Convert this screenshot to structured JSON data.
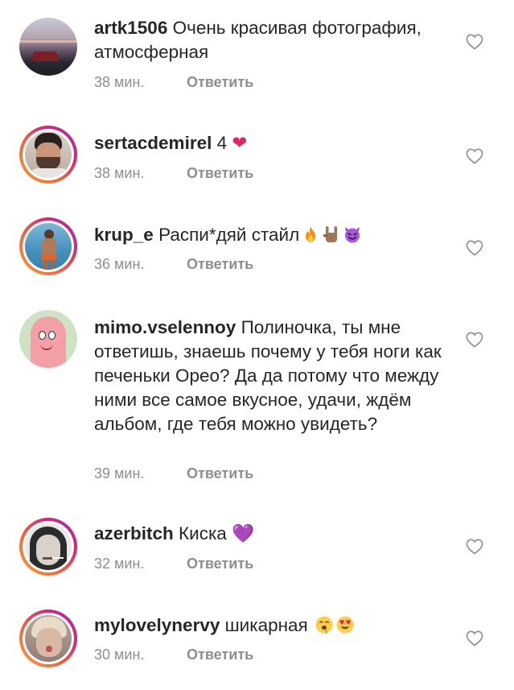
{
  "comments": [
    {
      "username": "artk1506",
      "text": "Очень красивая фотография, атмосферная",
      "time": "38 мин.",
      "reply": "Ответить"
    },
    {
      "username": "sertacdemirel",
      "text": "4",
      "emoji": "❤",
      "time": "38 мин.",
      "reply": "Ответить"
    },
    {
      "username": "krup_e",
      "text": "Распи*дяй стайл",
      "time": "36 мин.",
      "reply": "Ответить"
    },
    {
      "username": "mimo.vselennoy",
      "text": "Полиночка, ты мне ответишь, знаешь почему у тебя ноги как печеньки Орео? Да да потому что между ними все самое вкусное, удачи, ждём альбом, где тебя можно увидеть?",
      "time": "39 мин.",
      "reply": "Ответить"
    },
    {
      "username": "azerbitch",
      "text": "Киска",
      "emoji": "💜",
      "time": "32 мин.",
      "reply": "Ответить"
    },
    {
      "username": "mylovelynervy",
      "text": "шикарная",
      "time": "30 мин.",
      "reply": "Ответить"
    }
  ],
  "icons": {
    "like": "heart-outline-icon",
    "fire": "fire-emoji-icon",
    "horns": "sign-of-horns-emoji-icon",
    "devil": "smiling-devil-emoji-icon",
    "drool": "drooling-face-emoji-icon",
    "heart_eyes": "heart-eyes-emoji-icon"
  },
  "colors": {
    "text": "#262626",
    "secondary": "#8e8e8e",
    "red_heart": "#e0245e",
    "purple_heart": "#8a2be2"
  }
}
